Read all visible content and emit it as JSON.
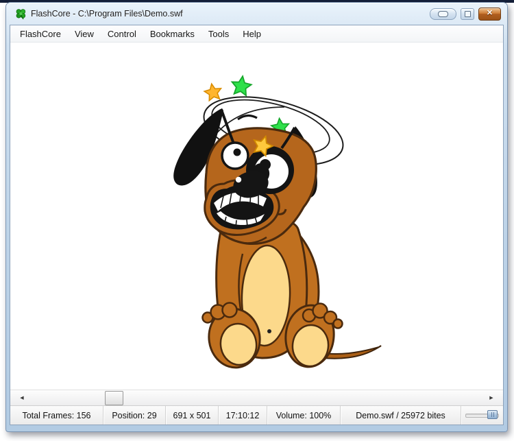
{
  "window": {
    "title": "FlashCore - C:\\Program Files\\Demo.swf",
    "app_icon": "green-clover",
    "controls": {
      "minimize_glyph": "pill",
      "maximize_glyph": "square",
      "close_glyph": "✕"
    }
  },
  "menu": {
    "items": [
      "FlashCore",
      "View",
      "Control",
      "Bookmarks",
      "Tools",
      "Help"
    ]
  },
  "canvas": {
    "subject": "dizzy cartoon dog sitting with stars and swirl halo spinning over its head"
  },
  "scrollbar": {
    "left_arrow": "◀",
    "right_arrow": "▶"
  },
  "status": {
    "panes": [
      "Total Frames: 156",
      "Position: 29",
      "691 x 501",
      "17:10:12",
      "Volume: 100%",
      "Demo.swf / 25972 bites"
    ],
    "volume_slider_position": "100%"
  },
  "colors": {
    "titlebar_blue": "#bdd3e8",
    "close_button_orange": "#cd7c35",
    "dog_body_brown": "#c0701f",
    "dog_head_brown": "#b5661c",
    "dog_outline": "#4a2a0e",
    "dog_belly_cream": "#fcd98b",
    "star_green": "#2ee04a",
    "star_orange": "#ffb52e",
    "star_gold": "#ffc83d",
    "statusbar_gray": "#ebebeb",
    "top_strip_navy": "#141f38"
  }
}
